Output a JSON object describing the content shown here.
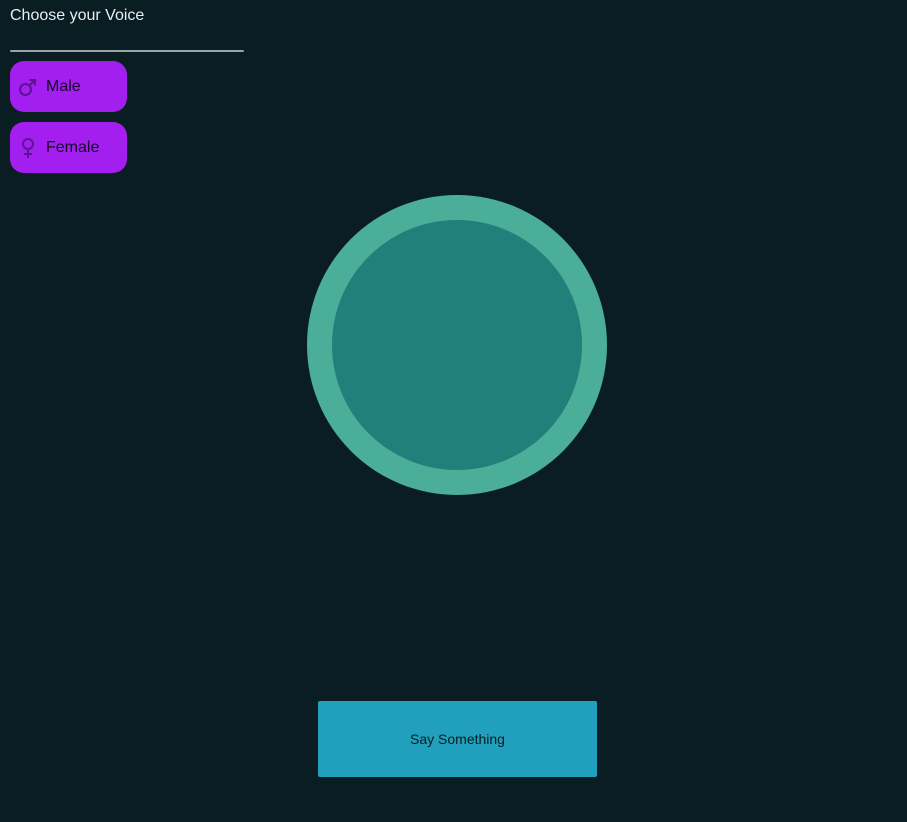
{
  "voice_picker": {
    "title": "Choose your Voice",
    "options": [
      {
        "label": "Male",
        "icon": "male-icon"
      },
      {
        "label": "Female",
        "icon": "female-icon"
      }
    ]
  },
  "orb": {
    "outer_color": "#4aae98",
    "inner_color": "#22807a"
  },
  "actions": {
    "say_label": "Say Something"
  },
  "colors": {
    "background": "#0a1d23",
    "voice_button": "#a31ff0",
    "say_button": "#20a0bd"
  }
}
